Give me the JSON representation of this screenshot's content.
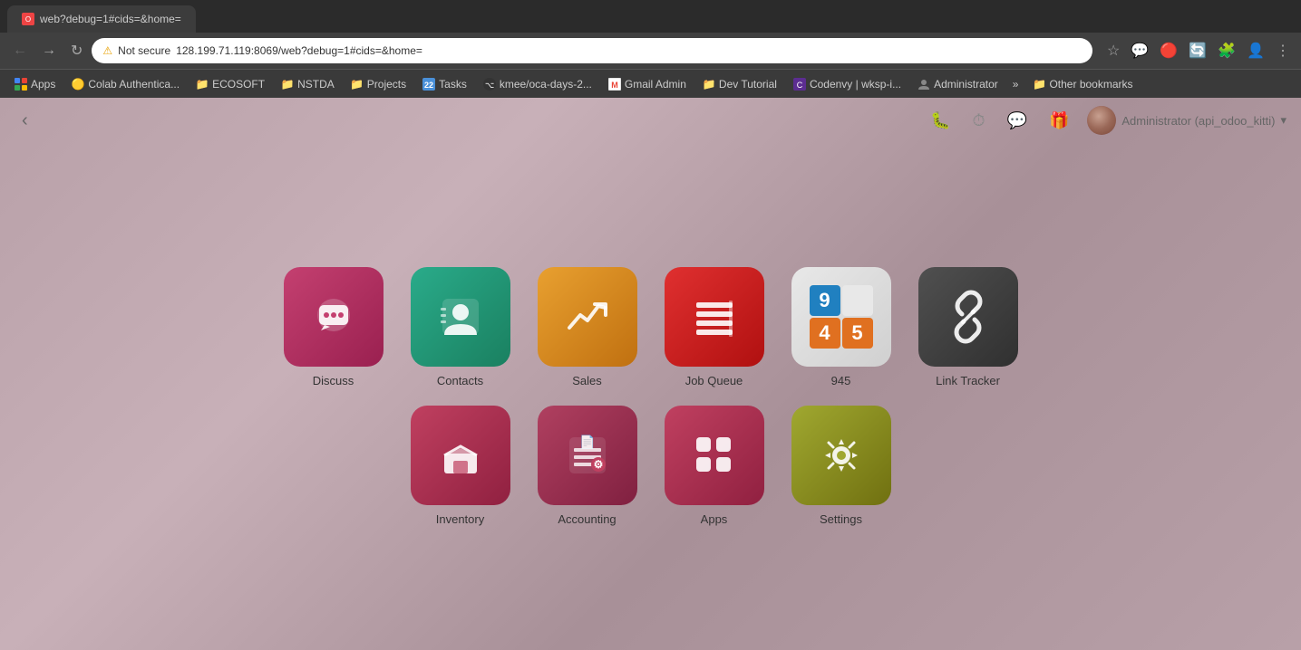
{
  "browser": {
    "tab_title": "web?debug=1#cids=&home=",
    "tab_favicon": "O",
    "address": "128.199.71.119:8069/web?debug=1#cids=&home=",
    "address_prefix": "Not secure",
    "bookmarks": [
      {
        "label": "Apps",
        "icon": "grid"
      },
      {
        "label": "Colab Authentica...",
        "icon": "circle"
      },
      {
        "label": "ECOSOFT",
        "icon": "folder"
      },
      {
        "label": "NSTDA",
        "icon": "folder"
      },
      {
        "label": "Projects",
        "icon": "folder"
      },
      {
        "label": "Tasks",
        "icon": "calendar",
        "count": "22"
      },
      {
        "label": "kmee/oca-days-2...",
        "icon": "github"
      },
      {
        "label": "Gmail Admin",
        "icon": "gmail"
      },
      {
        "label": "Dev Tutorial",
        "icon": "folder"
      },
      {
        "label": "Codenvy | wksp-i...",
        "icon": "codenvy"
      },
      {
        "label": "Administrator",
        "icon": "person"
      }
    ],
    "more_label": "»",
    "other_bookmarks": "Other bookmarks"
  },
  "odoo": {
    "back_label": "‹",
    "user_name": "Administrator (api_odoo_kitti)",
    "icons": {
      "debug": "🐛",
      "clock": "⏱",
      "chat": "💬",
      "gift": "🎁"
    }
  },
  "apps": {
    "row1": [
      {
        "id": "discuss",
        "label": "Discuss",
        "icon_class": "icon-discuss"
      },
      {
        "id": "contacts",
        "label": "Contacts",
        "icon_class": "icon-contacts"
      },
      {
        "id": "sales",
        "label": "Sales",
        "icon_class": "icon-sales"
      },
      {
        "id": "jobqueue",
        "label": "Job Queue",
        "icon_class": "icon-jobqueue"
      },
      {
        "id": "945",
        "label": "945",
        "icon_class": "icon-945"
      },
      {
        "id": "linktracker",
        "label": "Link Tracker",
        "icon_class": "icon-linktracker"
      }
    ],
    "row2": [
      {
        "id": "inventory",
        "label": "Inventory",
        "icon_class": "icon-inventory"
      },
      {
        "id": "accounting",
        "label": "Accounting",
        "icon_class": "icon-accounting"
      },
      {
        "id": "apps",
        "label": "Apps",
        "icon_class": "icon-apps"
      },
      {
        "id": "settings",
        "label": "Settings",
        "icon_class": "icon-settings"
      }
    ]
  }
}
